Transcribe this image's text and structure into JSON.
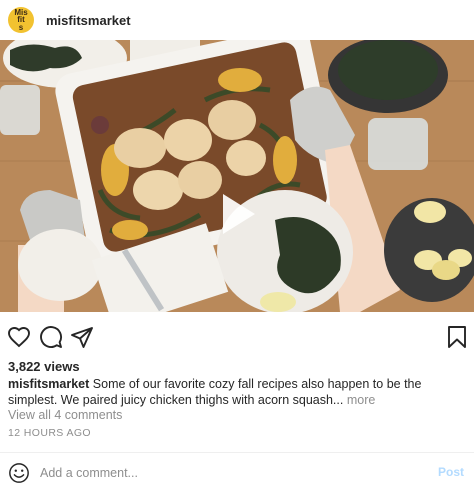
{
  "header": {
    "username": "misfitsmarket",
    "avatar_text": "Mis fit s",
    "avatar_color": "#f2c230"
  },
  "media": {
    "type": "video",
    "icons": {
      "play": "play-icon"
    }
  },
  "actions": {
    "icons": [
      "heart-icon",
      "comment-icon",
      "share-icon",
      "bookmark-icon"
    ]
  },
  "stats": {
    "views": "3,822 views"
  },
  "caption": {
    "username": "misfitsmarket",
    "text": "Some of our favorite cozy fall recipes also happen to be the simplest. We paired juicy chicken thighs with acorn squash...",
    "more": "more"
  },
  "comments": {
    "view_all": "View all 4 comments"
  },
  "timestamp": "12 HOURS AGO",
  "comment_box": {
    "placeholder": "Add a comment...",
    "post_label": "Post",
    "icon": "smiley-icon"
  },
  "colors": {
    "post_disabled": "#b3dbff",
    "muted_text": "#8e8e8e"
  }
}
